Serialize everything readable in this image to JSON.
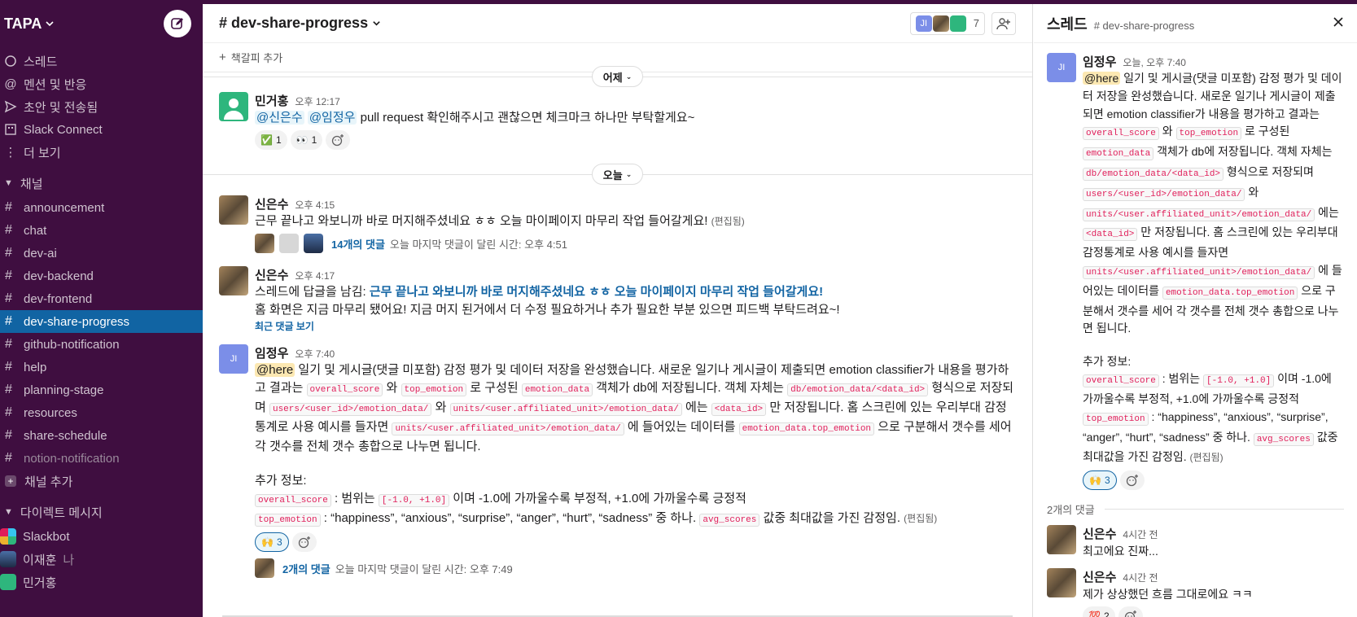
{
  "workspace": {
    "name": "TAPA"
  },
  "sidebar": {
    "nav": [
      {
        "label": "스레드",
        "icon": "threads-icon"
      },
      {
        "label": "멘션 및 반응",
        "icon": "at-icon"
      },
      {
        "label": "초안 및 전송됨",
        "icon": "send-icon"
      },
      {
        "label": "Slack Connect",
        "icon": "building-icon"
      },
      {
        "label": "더 보기",
        "icon": "more-vertical-icon"
      }
    ],
    "channels_section": "채널",
    "channels": [
      {
        "label": "announcement"
      },
      {
        "label": "chat"
      },
      {
        "label": "dev-ai"
      },
      {
        "label": "dev-backend"
      },
      {
        "label": "dev-frontend"
      },
      {
        "label": "dev-share-progress",
        "active": true
      },
      {
        "label": "github-notification"
      },
      {
        "label": "help"
      },
      {
        "label": "planning-stage"
      },
      {
        "label": "resources"
      },
      {
        "label": "share-schedule"
      },
      {
        "label": "notion-notification",
        "muted": true
      }
    ],
    "add_channel": "채널 추가",
    "dm_section": "다이렉트 메시지",
    "dms": [
      {
        "label": "Slackbot"
      },
      {
        "label": "이재훈",
        "suffix": "나"
      },
      {
        "label": "민거홍"
      }
    ]
  },
  "channel": {
    "name": "# dev-share-progress",
    "member_count": "7",
    "bookmark_add": "책갈피 추가",
    "day_yesterday": "어제",
    "day_today": "오늘"
  },
  "messages": {
    "m1": {
      "author": "민거홍",
      "time": "오후 12:17",
      "mention1": "@신은수",
      "mention2": "@임정우",
      "text": " pull request 확인해주시고 괜찮으면 체크마크 하나만 부탁할게요~",
      "r1_emoji": "✅",
      "r1_count": "1",
      "r2_emoji": "👀",
      "r2_count": "1"
    },
    "m2": {
      "author": "신은수",
      "time": "오후 4:15",
      "text": "근무 끝나고 와보니까 바로 머지해주셨네요 ㅎㅎ 오늘 마이페이지 마무리 작업 들어갈게요!",
      "edited": "(편집됨)",
      "replies": "14개의 댓글",
      "last_reply": "오늘 마지막 댓글이 달린 시간: 오후 4:51"
    },
    "m3": {
      "author": "신은수",
      "time": "오후 4:17",
      "prefix": "스레드에 답글을 남김: ",
      "quoted": "근무 끝나고 와보니까 바로 머지해주셨네요 ㅎㅎ 오늘 마이페이지 마무리 작업 들어갈게요!",
      "text": "홈 화면은 지금 마무리 됐어요! 지금 머지 된거에서 더 수정 필요하거나 추가 필요한 부분 있으면 피드백 부탁드려요~!",
      "view_recent": "최근 댓글 보기"
    },
    "m4": {
      "author": "임정우",
      "time": "오후 7:40",
      "avatar": "JI",
      "here": "@here",
      "t1": " 일기 및 게시글(댓글 미포함) 감정 평가 및 데이터 저장을 완성했습니다. 새로운 일기나 게시글이 제출되면 emotion classifier가 내용을 평가하고 결과는 ",
      "c1": "overall_score",
      "t2": " 와 ",
      "c2": "top_emotion",
      "t3": " 로 구성된 ",
      "c3": "emotion_data",
      "t4": " 객체가 db에 저장됩니다. 객체 자체는 ",
      "c4": "db/emotion_data/<data_id>",
      "t5": " 형식으로 저장되며 ",
      "c5": "users/<user_id>/emotion_data/",
      "t6": " 와 ",
      "c6": "units/<user.affiliated_unit>/emotion_data/",
      "t7": " 에는 ",
      "c7": "<data_id>",
      "t8": " 만 저장됩니다. 홈 스크린에 있는 우리부대 감정통계로 사용 예시를 들자면 ",
      "c8": "units/<user.affiliated_unit>/emotion_data/",
      "t9": " 에 들어있는 데이터를 ",
      "c9": "emotion_data.top_emotion",
      "t10": " 으로 구분해서 갯수를 세어 각 갯수를 전체 갯수 총합으로 나누면 됩니다.",
      "extra": "추가 정보:",
      "c10": "overall_score",
      "t11": " : 범위는 ",
      "c11": "[-1.0, +1.0]",
      "t12": " 이며 -1.0에 가까울수록 부정적, +1.0에 가까울수록 긍정적",
      "c12": "top_emotion",
      "t13": " : “happiness”, “anxious”, “surprise”, “anger”, “hurt”, “sadness” 중 하나. ",
      "c13": "avg_scores",
      "t14": " 값중 최대값을 가진 감정임.",
      "edited": "(편집됨)",
      "r1_emoji": "🙌",
      "r1_count": "3",
      "replies": "2개의 댓글",
      "last_reply": "오늘 마지막 댓글이 달린 시간: 오후 7:49"
    }
  },
  "thread": {
    "title": "스레드",
    "channel": "# dev-share-progress",
    "parent_time": "오늘, 오후 7:40",
    "reply_count": "2개의 댓글",
    "replies": [
      {
        "author": "신은수",
        "time": "4시간 전",
        "text": "최고에요 진짜..."
      },
      {
        "author": "신은수",
        "time": "4시간 전",
        "text": "제가 상상했던 흐름 그대로에요 ㅋㅋ",
        "r_emoji": "💯",
        "r_count": "2"
      }
    ]
  }
}
